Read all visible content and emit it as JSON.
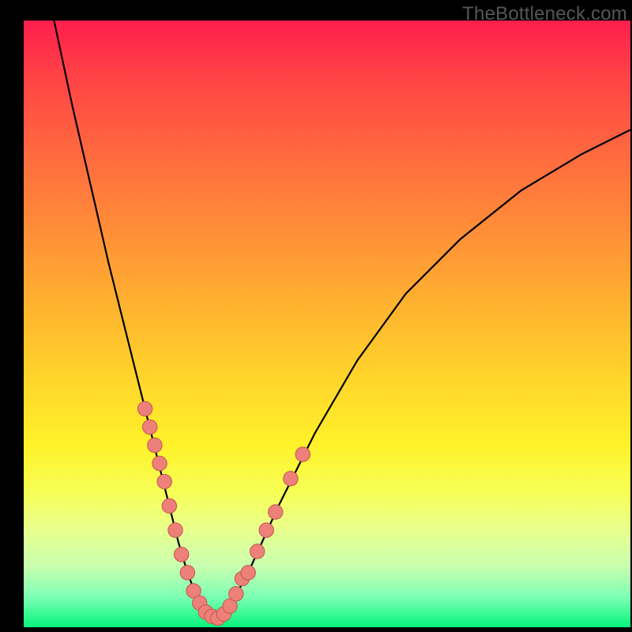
{
  "watermark": "TheBottleneck.com",
  "colors": {
    "dot_fill": "#ed8079",
    "dot_stroke": "#c1574f",
    "curve": "#000000"
  },
  "chart_data": {
    "type": "line",
    "title": "",
    "xlabel": "",
    "ylabel": "",
    "xlim": [
      0,
      100
    ],
    "ylim": [
      0,
      100
    ],
    "grid": false,
    "legend": false,
    "annotations": [
      "TheBottleneck.com"
    ],
    "series": [
      {
        "name": "bottleneck-curve",
        "x": [
          5,
          8,
          11,
          14,
          17,
          20,
          22,
          24,
          25.5,
          27,
          28.5,
          30,
          32,
          34,
          37,
          42,
          48,
          55,
          63,
          72,
          82,
          92,
          100
        ],
        "y": [
          100,
          86,
          73,
          60,
          48,
          36,
          28,
          20,
          14,
          9,
          5,
          2.5,
          1.5,
          3.5,
          9,
          20,
          32,
          44,
          55,
          64,
          72,
          78,
          82
        ]
      }
    ],
    "highlight_points": [
      {
        "x": 20.0,
        "y": 36.0
      },
      {
        "x": 20.8,
        "y": 33.0
      },
      {
        "x": 21.6,
        "y": 30.0
      },
      {
        "x": 22.4,
        "y": 27.0
      },
      {
        "x": 23.2,
        "y": 24.0
      },
      {
        "x": 24.0,
        "y": 20.0
      },
      {
        "x": 25.0,
        "y": 16.0
      },
      {
        "x": 26.0,
        "y": 12.0
      },
      {
        "x": 27.0,
        "y": 9.0
      },
      {
        "x": 28.0,
        "y": 6.0
      },
      {
        "x": 29.0,
        "y": 4.0
      },
      {
        "x": 30.0,
        "y": 2.5
      },
      {
        "x": 31.0,
        "y": 1.8
      },
      {
        "x": 32.0,
        "y": 1.5
      },
      {
        "x": 33.0,
        "y": 2.2
      },
      {
        "x": 34.0,
        "y": 3.5
      },
      {
        "x": 35.0,
        "y": 5.5
      },
      {
        "x": 36.0,
        "y": 8.0
      },
      {
        "x": 37.0,
        "y": 9.0
      },
      {
        "x": 38.5,
        "y": 12.5
      },
      {
        "x": 40.0,
        "y": 16.0
      },
      {
        "x": 41.5,
        "y": 19.0
      },
      {
        "x": 44.0,
        "y": 24.5
      },
      {
        "x": 46.0,
        "y": 28.5
      }
    ],
    "dot_radius_fraction": 0.012
  }
}
